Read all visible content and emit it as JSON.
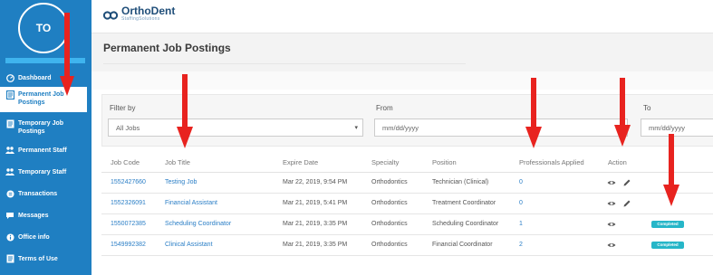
{
  "colors": {
    "sidebar": "#1f7fc2",
    "accent": "#2a7ec6",
    "badge": "#26b6c8",
    "arrow": "#e8231f"
  },
  "user": {
    "initials": "TO"
  },
  "sidebar": {
    "items": [
      {
        "label": "Dashboard",
        "icon": "dashboard-icon",
        "active": false
      },
      {
        "label": "Permanent Job Postings",
        "icon": "document-icon",
        "active": true
      },
      {
        "label": "Temporary Job Postings",
        "icon": "document-icon",
        "active": false
      },
      {
        "label": "Permanent Staff",
        "icon": "users-icon",
        "active": false
      },
      {
        "label": "Temporary Staff",
        "icon": "users-icon",
        "active": false
      },
      {
        "label": "Transactions",
        "icon": "transactions-icon",
        "active": false
      },
      {
        "label": "Messages",
        "icon": "messages-icon",
        "active": false
      },
      {
        "label": "Office info",
        "icon": "info-icon",
        "active": false
      },
      {
        "label": "Terms of Use",
        "icon": "document-icon",
        "active": false
      }
    ]
  },
  "header": {
    "brand": "OrthoDent",
    "brand_sub": "StaffingSolutions"
  },
  "page": {
    "title": "Permanent Job Postings"
  },
  "filters": {
    "filter_by": {
      "label": "Filter by",
      "value": "All Jobs"
    },
    "from": {
      "label": "From",
      "placeholder": "mm/dd/yyyy"
    },
    "to": {
      "label": "To",
      "placeholder": "mm/dd/yyyy"
    }
  },
  "table": {
    "columns": [
      "Job Code",
      "Job Title",
      "Expire Date",
      "Specialty",
      "Position",
      "Professionals Applied",
      "Action"
    ],
    "rows": [
      {
        "code": "1552427660",
        "title": "Testing Job",
        "expire": "Mar 22, 2019, 9:54 PM",
        "specialty": "Orthodontics",
        "position": "Technician (Clinical)",
        "applied": "0",
        "actions": [
          "view",
          "edit"
        ],
        "status": ""
      },
      {
        "code": "1552326091",
        "title": "Financial Assistant",
        "expire": "Mar 21, 2019, 5:41 PM",
        "specialty": "Orthodontics",
        "position": "Treatment Coordinator",
        "applied": "0",
        "actions": [
          "view",
          "edit"
        ],
        "status": ""
      },
      {
        "code": "1550072385",
        "title": "Scheduling Coordinator",
        "expire": "Mar 21, 2019, 3:35 PM",
        "specialty": "Orthodontics",
        "position": "Scheduling Coordinator",
        "applied": "1",
        "actions": [
          "view"
        ],
        "status": "Completed"
      },
      {
        "code": "1549992382",
        "title": "Clinical Assistant",
        "expire": "Mar 21, 2019, 3:35 PM",
        "specialty": "Orthodontics",
        "position": "Financial Coordinator",
        "applied": "2",
        "actions": [
          "view"
        ],
        "status": "Completed"
      }
    ]
  }
}
